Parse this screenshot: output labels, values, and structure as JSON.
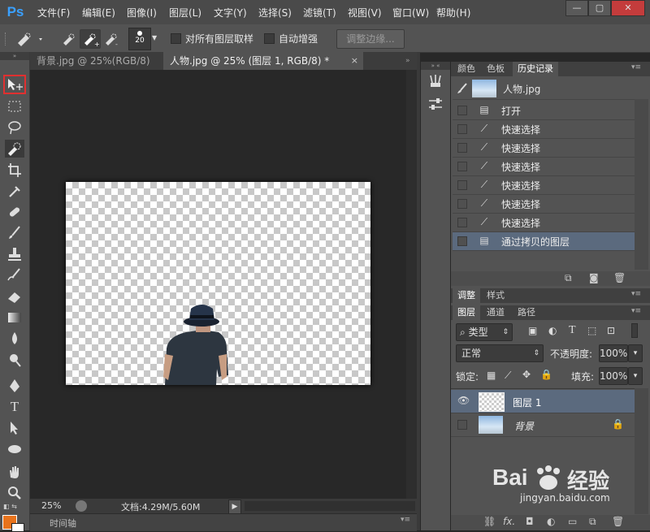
{
  "app": {
    "logo": "Ps"
  },
  "menu": [
    "文件(F)",
    "编辑(E)",
    "图像(I)",
    "图层(L)",
    "文字(Y)",
    "选择(S)",
    "滤镜(T)",
    "视图(V)",
    "窗口(W)",
    "帮助(H)"
  ],
  "window_buttons": [
    "—",
    "▢",
    "✕"
  ],
  "options": {
    "brush_size": "20",
    "sample_all_layers": "对所有图层取样",
    "auto_enhance": "自动增强",
    "refine_edge": "调整边缘..."
  },
  "tabs": [
    {
      "label": "背景.jpg @ 25%(RGB/8)"
    },
    {
      "label": "人物.jpg @ 25% (图层 1, RGB/8) *"
    }
  ],
  "status": {
    "zoom": "25%",
    "doc_info": "文档:4.29M/5.60M"
  },
  "timeline": {
    "label": "时间轴"
  },
  "panels": {
    "top_tabs": [
      "颜色",
      "色板",
      "历史记录"
    ],
    "history": {
      "snapshot": "人物.jpg",
      "items": [
        {
          "label": "打开",
          "icon": "doc-icon"
        },
        {
          "label": "快速选择",
          "icon": "quick-select-icon"
        },
        {
          "label": "快速选择",
          "icon": "quick-select-icon"
        },
        {
          "label": "快速选择",
          "icon": "quick-select-icon"
        },
        {
          "label": "快速选择",
          "icon": "quick-select-icon"
        },
        {
          "label": "快速选择",
          "icon": "quick-select-icon"
        },
        {
          "label": "快速选择",
          "icon": "quick-select-icon"
        },
        {
          "label": "通过拷贝的图层",
          "icon": "doc-icon"
        }
      ]
    },
    "adjust_tabs": [
      "调整",
      "样式"
    ],
    "layer_tabs": [
      "图层",
      "通道",
      "路径"
    ],
    "layers": {
      "filter": "类型",
      "blend_mode": "正常",
      "opacity_label": "不透明度:",
      "opacity": "100%",
      "lock_label": "锁定:",
      "fill_label": "填充:",
      "fill": "100%",
      "items": [
        {
          "name": "图层 1",
          "selected": true
        },
        {
          "name": "背景",
          "selected": false
        }
      ]
    }
  },
  "watermark": {
    "brand": "Bai",
    "brand2": "经验",
    "url": "jingyan.baidu.com"
  },
  "colors": {
    "accent": "#3aa0ff",
    "selection_red": "#e03030",
    "foreground": "#e8731c"
  }
}
